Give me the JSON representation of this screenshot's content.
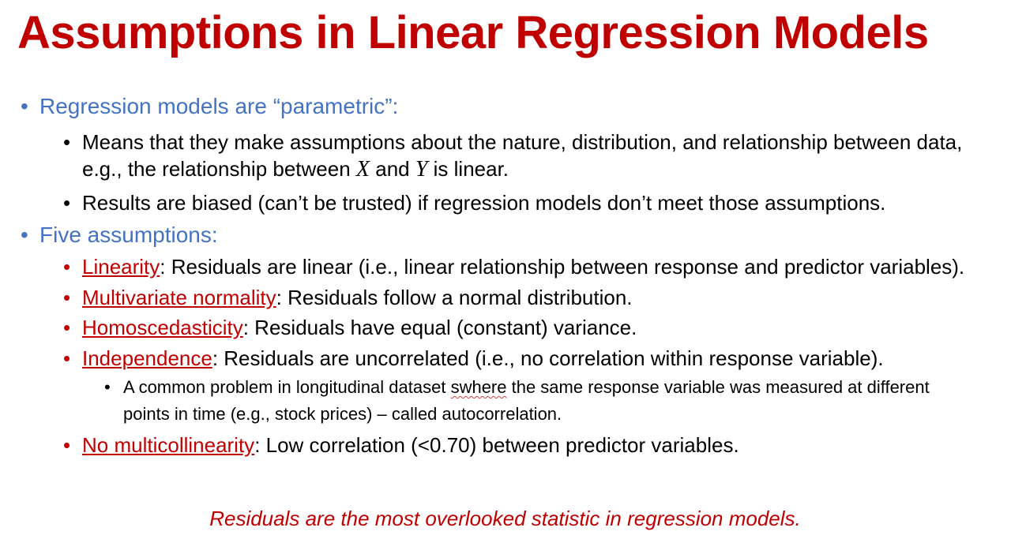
{
  "title": "Assumptions in Linear Regression Models",
  "colors": {
    "title": "#c00000",
    "level1": "#4472c4",
    "term": "#c00000",
    "footer": "#c00000"
  },
  "bullets": {
    "parametric": {
      "label": "Regression models are “parametric”:",
      "sub": {
        "means_line1": "Means that they make assumptions about the nature, distribution, and relationship between data,",
        "means_line2_pre": "e.g., the relationship between ",
        "var_x": "X",
        "means_line2_mid": " and ",
        "var_y": "Y",
        "means_line2_post": " is linear.",
        "biased": "Results are biased (can’t be trusted) if regression models don’t meet those assumptions."
      }
    },
    "five": {
      "label": "Five assumptions:",
      "items": [
        {
          "term": "Linearity",
          "desc": ": Residuals are linear (i.e., linear relationship between response and predictor variables)."
        },
        {
          "term": "Multivariate normality",
          "desc": ": Residuals follow a normal distribution."
        },
        {
          "term": "Homoscedasticity",
          "desc": ": Residuals have equal (constant) variance."
        },
        {
          "term": "Independence",
          "desc": ": Residuals are uncorrelated (i.e., no correlation within response variable)."
        },
        {
          "term": "No multicollinearity",
          "desc": ": Low correlation (<0.70) between predictor variables."
        }
      ],
      "independence_note": {
        "line1_pre": "A common problem in longitudinal dataset ",
        "line1_squiggle": "swhere",
        "line1_post": " the same response variable was measured at different",
        "line2": "points in time (e.g., stock prices) – called autocorrelation."
      }
    }
  },
  "footer": "Residuals are the most overlooked statistic in regression models."
}
